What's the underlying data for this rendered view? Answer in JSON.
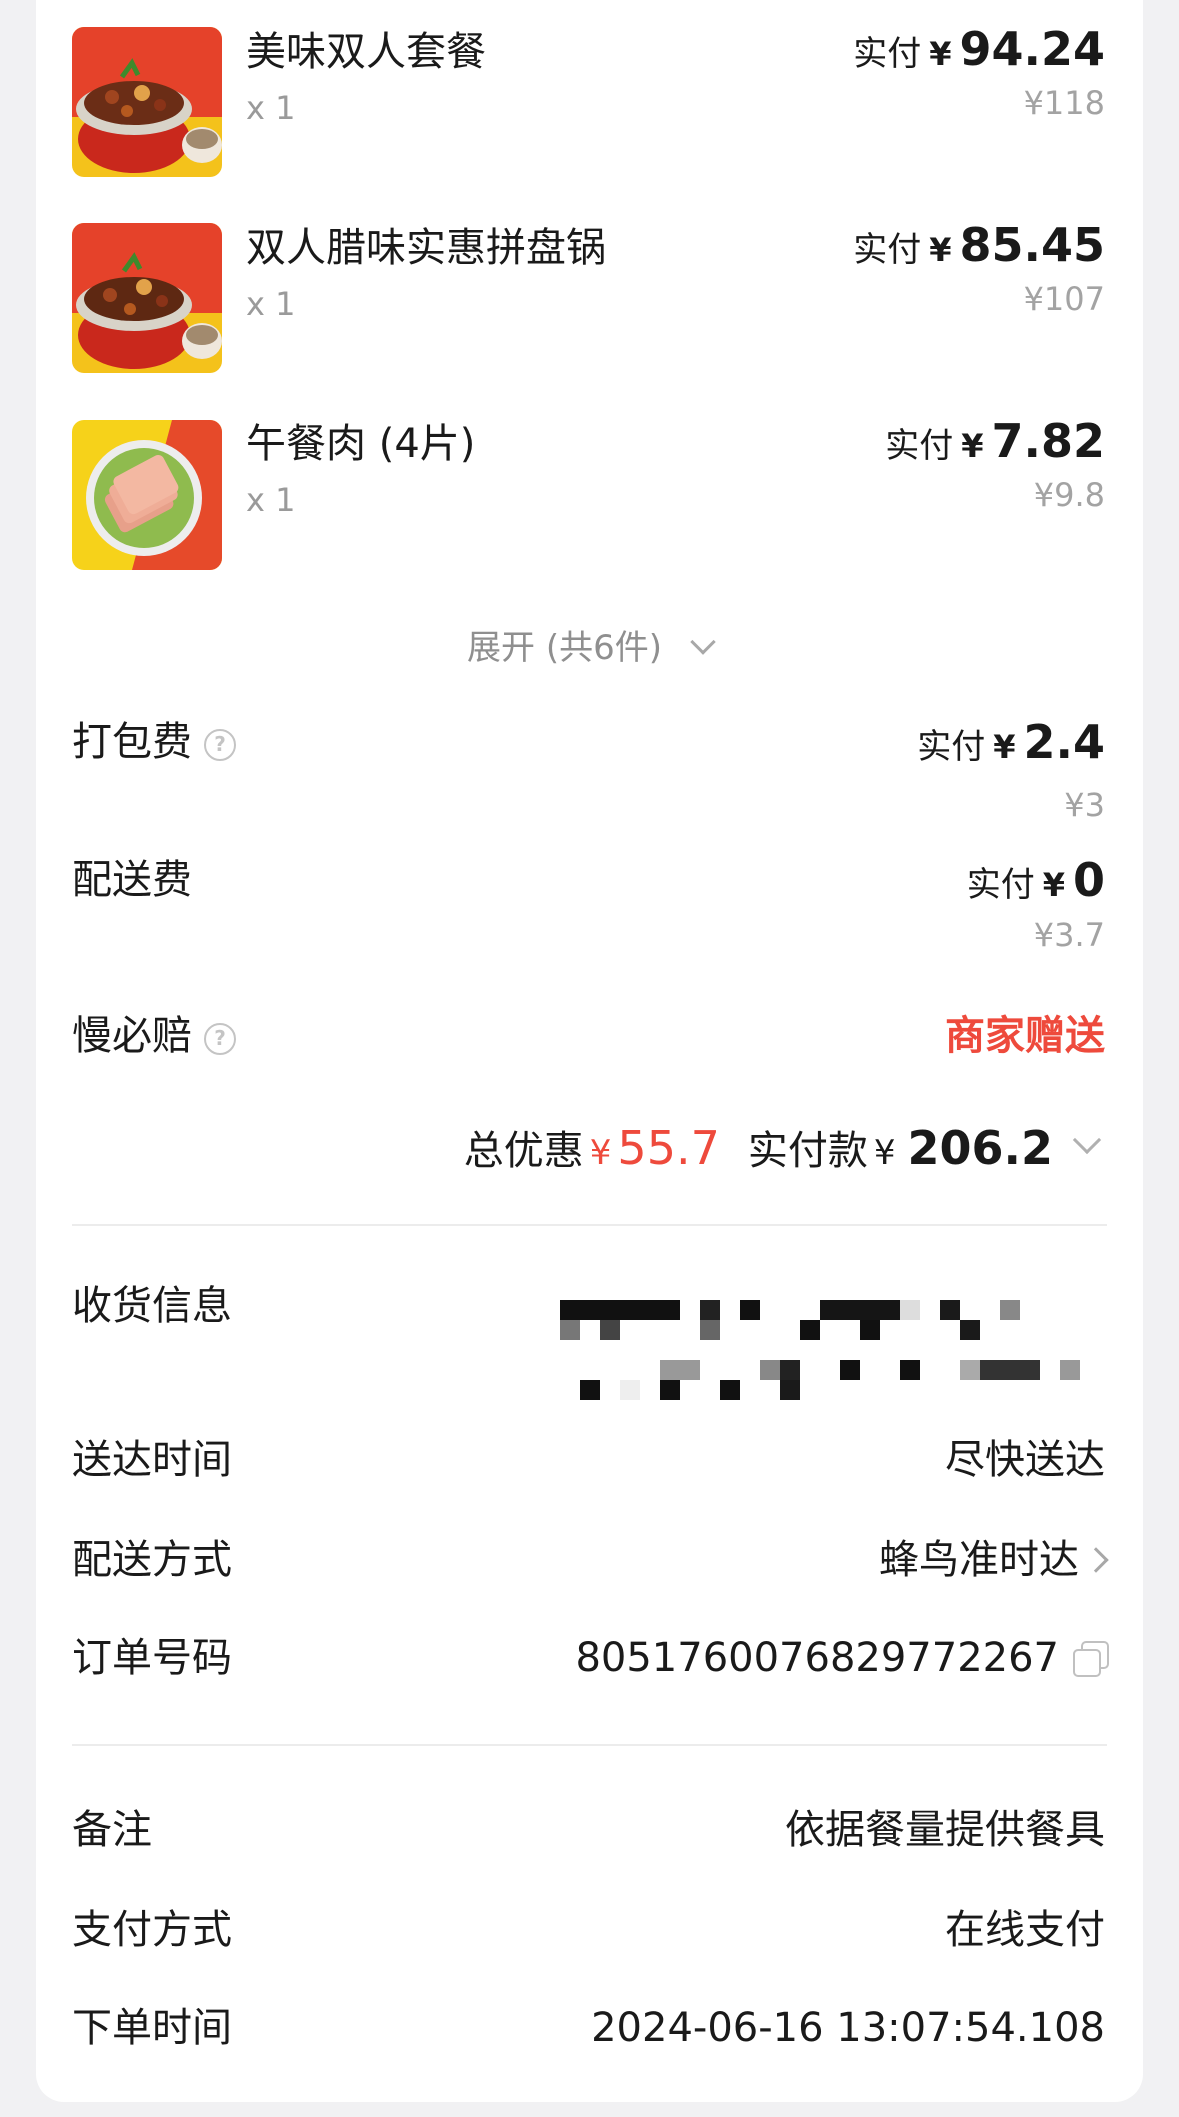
{
  "items": [
    {
      "name": "美味双人套餐",
      "qty": "x 1",
      "paid_label": "实付",
      "currency": "¥",
      "paid": "94.24",
      "original": "¥118"
    },
    {
      "name": "双人腊味实惠拼盘锅",
      "qty": "x 1",
      "paid_label": "实付",
      "currency": "¥",
      "paid": "85.45",
      "original": "¥107"
    },
    {
      "name": "午餐肉 (4片)",
      "qty": "x 1",
      "paid_label": "实付",
      "currency": "¥",
      "paid": "7.82",
      "original": "¥9.8"
    }
  ],
  "expand_label": "展开 (共6件)",
  "fees": {
    "packing": {
      "label": "打包费",
      "paid_label": "实付",
      "currency": "¥",
      "paid": "2.4",
      "original": "¥3"
    },
    "delivery": {
      "label": "配送费",
      "paid_label": "实付",
      "currency": "¥",
      "paid": "0",
      "original": "¥3.7"
    },
    "slow_compensation": {
      "label": "慢必赔",
      "value": "商家赠送"
    }
  },
  "summary": {
    "discount_label": "总优惠",
    "discount_currency": "¥",
    "discount": "55.7",
    "total_label": "实付款",
    "total_currency": "¥",
    "total": "206.2"
  },
  "info": {
    "receiver_label": "收货信息",
    "delivery_time_label": "送达时间",
    "delivery_time": "尽快送达",
    "delivery_method_label": "配送方式",
    "delivery_method": "蜂鸟准时达",
    "order_no_label": "订单号码",
    "order_no": "8051760076829772267"
  },
  "extra": {
    "note_label": "备注",
    "note": "依据餐量提供餐具",
    "payment_label": "支付方式",
    "payment": "在线支付",
    "order_time_label": "下单时间",
    "order_time": "2024-06-16 13:07:54.108"
  },
  "colors": {
    "accent_red": "#ee4a3c",
    "text": "#1a1a1a",
    "muted": "#a3a3a3"
  }
}
